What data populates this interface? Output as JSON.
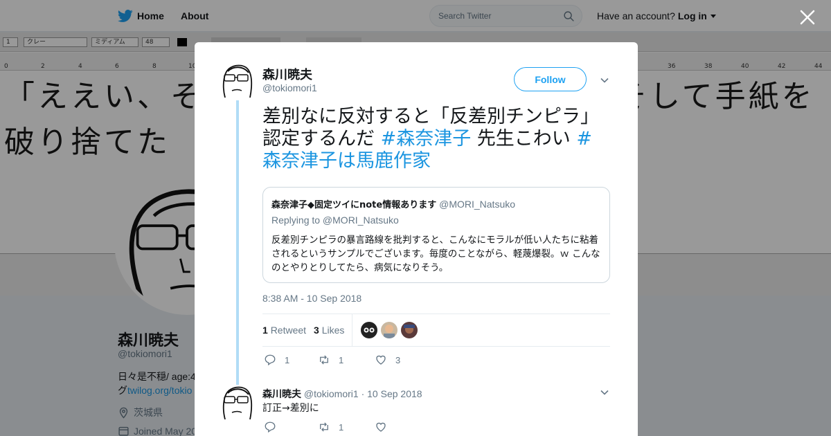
{
  "nav": {
    "home_label": "Home",
    "about_label": "About",
    "search_placeholder": "Search Twitter",
    "have_account": "Have an account?",
    "login_label": "Log in"
  },
  "banner": {
    "font_select": "クレー",
    "weight_select": "ミディアム",
    "size_select": "48",
    "ruler_numbers": [
      "0",
      "2",
      "4",
      "6",
      "8",
      "10",
      "36",
      "38",
      "40",
      "42",
      "44"
    ],
    "doc_line1_left": "「ええい、そ",
    "doc_line1_right": "そして手紙を",
    "doc_line2": "破り捨てた"
  },
  "profile": {
    "name": "森川暁夫",
    "handle": "@tokiomori1",
    "bio_line1": "日々是不穏/ age:4",
    "bio_line2_prefix": "グ",
    "bio_link": "twilog.org/tokio",
    "location": "茨城県",
    "joined": "Joined May 20"
  },
  "tweet": {
    "author_name": "森川暁夫",
    "author_handle": "@tokiomori1",
    "follow_label": "Follow",
    "text_line1": "差別なに反対すると「反差別チンピラ」",
    "text_line2_plain": "認定するんだ ",
    "hashtag1": "#森奈津子",
    "text_line2_mid": " 先生こわい ",
    "hashtag2_part1": "#",
    "hashtag2_part2": "森奈津子は馬鹿作家",
    "quote": {
      "name": "森奈津子◆固定ツイにnote情報あります",
      "handle": "@MORI_Natsuko",
      "replying_to": "Replying to @MORI_Natsuko",
      "body": "反差別チンピラの暴言路線を批判すると、こんなにモラルが低い人たちに粘着されるというサンプルでございます。毎度のことながら、軽蔑爆裂。ｗ こんなのとやりとりしてたら、病気になりそう。"
    },
    "timestamp": "8:38 AM - 10 Sep 2018",
    "retweet_count": "1",
    "retweet_label": "Retweet",
    "likes_count": "3",
    "likes_label": "Likes",
    "reply_action_count": "1",
    "retweet_action_count": "1",
    "like_action_count": "3"
  },
  "reply": {
    "author_name": "森川暁夫",
    "author_handle": "@tokiomori1",
    "separator": "·",
    "date": "10 Sep 2018",
    "text": "訂正→差別に",
    "reply_action_count": "",
    "retweet_action_count": "1",
    "like_action_count": ""
  },
  "colors": {
    "twitter_blue": "#1da1f2",
    "hashtag_blue": "#1b95e0",
    "thread_line": "#b1dcf6",
    "muted_text": "#657786"
  },
  "icons": [
    "twitter-bird-icon",
    "search-icon",
    "close-icon",
    "chevron-down-icon",
    "reply-icon",
    "retweet-icon",
    "heart-icon",
    "location-icon",
    "calendar-icon"
  ]
}
